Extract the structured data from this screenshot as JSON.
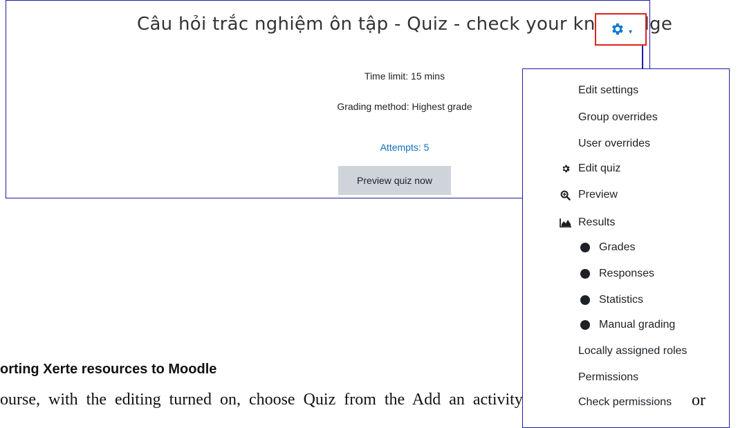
{
  "quiz": {
    "title": "Câu hỏi trắc nghiệm ôn tập - Quiz - check your knowledge",
    "time_limit": "Time limit: 15 mins",
    "grading_method": "Grading method: Highest grade",
    "attempts": "Attempts: 5",
    "preview_button": "Preview quiz now"
  },
  "settings_menu": {
    "icon": "gear-icon",
    "items": [
      {
        "label": "Edit settings"
      },
      {
        "label": "Group overrides"
      },
      {
        "label": "User overrides"
      },
      {
        "label": "Edit quiz",
        "icon": "gear-icon"
      },
      {
        "label": "Preview",
        "icon": "magnify-icon"
      },
      {
        "label": "Results",
        "icon": "area-chart-icon"
      },
      {
        "label": "Grades",
        "icon": "bullet-icon"
      },
      {
        "label": "Responses",
        "icon": "bullet-icon"
      },
      {
        "label": "Statistics",
        "icon": "bullet-icon"
      },
      {
        "label": "Manual grading",
        "icon": "bullet-icon"
      },
      {
        "label": "Locally assigned roles"
      },
      {
        "label": "Permissions"
      },
      {
        "label": "Check permissions"
      }
    ]
  },
  "document": {
    "heading": "orting Xerte resources to Moodle",
    "body": "ourse, with the editing turned on, choose Quiz from the Add an activity or",
    "overlay": "or"
  },
  "colors": {
    "annotation_blue": "#1a1aa6",
    "highlight_red": "#e02020",
    "link_blue": "#0f6cbf",
    "button_gray": "#ced4da"
  }
}
